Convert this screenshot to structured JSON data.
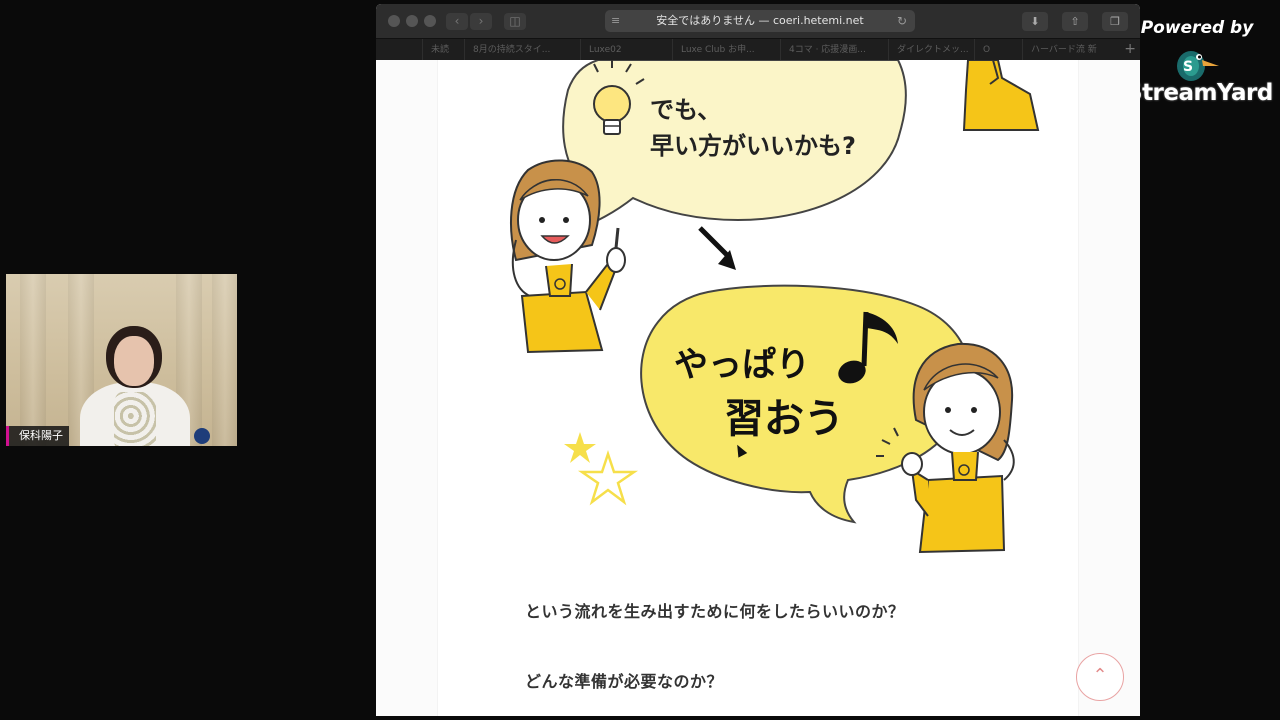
{
  "branding": {
    "powered_by": "Powered by",
    "name": "StreamYard"
  },
  "webcam": {
    "participant_name": "保科陽子"
  },
  "browser": {
    "address_text": "安全ではありません — coeri.hetemi.net",
    "tabs": [
      "未読",
      "8月の持続スタイ...",
      "Luxe02",
      "Luxe Club お申...",
      "4コマ · 応援漫画...",
      "ダイレクトメッ...",
      "O",
      "ハーバード流 新"
    ]
  },
  "illustration": {
    "bubble1_line1": "でも、",
    "bubble1_line2": "早い方がいいかも?",
    "bubble2_line1": "やっぱり",
    "bubble2_line2": "習おう"
  },
  "content": {
    "paragraph1": "という流れを生み出すために何をしたらいいのか？",
    "paragraph2": "どんな準備が必要なのか？",
    "scroll_top_icon": "chevron-up-icon"
  },
  "colors": {
    "bubble_pale": "#fbf5c8",
    "bubble_bright": "#f8e86a",
    "sweater": "#f5c518",
    "star_yellow": "#f6df4a",
    "scroll_top_accent": "#e38b8b",
    "cam_label_accent": "#d01090"
  }
}
